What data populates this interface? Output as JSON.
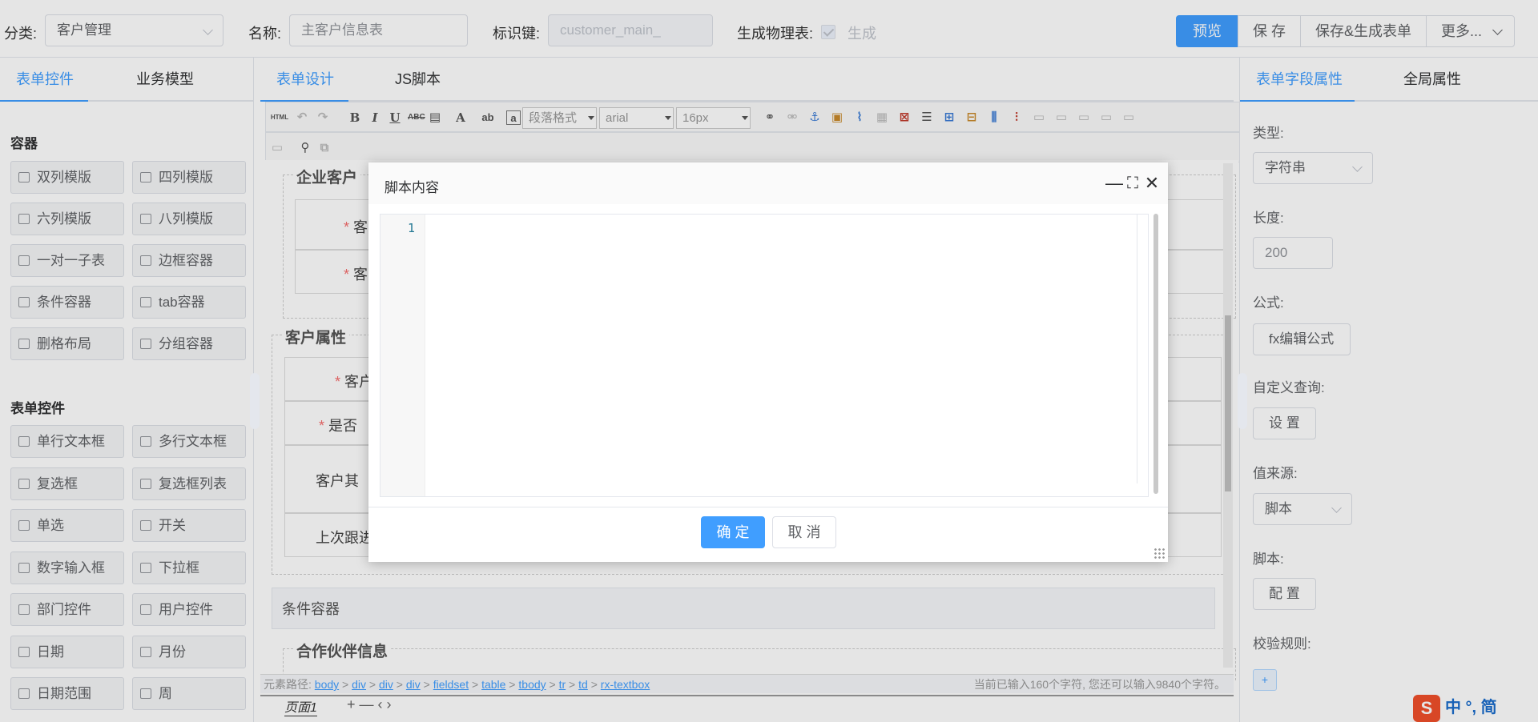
{
  "topbar": {
    "category_label": "分类:",
    "category_value": "客户管理",
    "name_label": "名称:",
    "name_placeholder": "主客户信息表",
    "key_label": "标识键:",
    "key_value": "customer_main_",
    "physical_label": "生成物理表:",
    "generate_label": "生成",
    "buttons": {
      "preview": "预览",
      "save": "保 存",
      "save_generate": "保存&生成表单",
      "more": "更多..."
    }
  },
  "sidebar": {
    "tabs": [
      "表单控件",
      "业务模型"
    ],
    "container_title": "容器",
    "containers": [
      "双列模版",
      "四列模版",
      "六列模版",
      "八列模版",
      "一对一子表",
      "边框容器",
      "条件容器",
      "tab容器",
      "删格布局",
      "分组容器"
    ],
    "controls_title": "表单控件",
    "controls": [
      "单行文本框",
      "多行文本框",
      "复选框",
      "复选框列表",
      "单选",
      "开关",
      "数字输入框",
      "下拉框",
      "部门控件",
      "用户控件",
      "日期",
      "月份",
      "日期范围",
      "周"
    ]
  },
  "center": {
    "tabs": [
      "表单设计",
      "JS脚本"
    ],
    "toolbar": {
      "html_btn": "HTML",
      "paragraph": "段落格式",
      "font": "arial",
      "size": "16px"
    },
    "fieldsets": {
      "enterprise": "企业客户",
      "enterprise_rows": [
        "客",
        "客"
      ],
      "customer_attr": "客户属性",
      "attr_rows": [
        "客户",
        "是否",
        "客户其",
        "上次跟进"
      ],
      "condition": "条件容器",
      "partner": "合作伙伴信息"
    },
    "status": {
      "path_label": "元素路径:",
      "path": [
        "body",
        "div",
        "div",
        "div",
        "fieldset",
        "table",
        "tbody",
        "tr",
        "td",
        "rx-textbox"
      ],
      "count_text": "当前已输入160个字符, 您还可以输入9840个字符。"
    },
    "page_tab": "页面1",
    "page_controls": "+ — ‹ ›"
  },
  "rpanel": {
    "tabs": [
      "表单字段属性",
      "全局属性"
    ],
    "type_label": "类型:",
    "type_value": "字符串",
    "length_label": "长度:",
    "length_value": "200",
    "formula_label": "公式:",
    "formula_btn": "fx编辑公式",
    "custom_query_label": "自定义查询:",
    "custom_query_btn": "设 置",
    "value_source_label": "值来源:",
    "value_source_value": "脚本",
    "script_label": "脚本:",
    "script_btn": "配 置",
    "validation_label": "校验规则:",
    "plus": "+"
  },
  "ime": {
    "logo": "S",
    "text": "中 °, 简"
  },
  "modal": {
    "title": "脚本内容",
    "minimize": "—",
    "maximize": "⛶",
    "close": "✕",
    "line_number": "1",
    "ok": "确 定",
    "cancel": "取 消"
  },
  "colors": {
    "primary": "#409eff",
    "danger": "#f56c6c",
    "border": "#dcdfe6"
  }
}
